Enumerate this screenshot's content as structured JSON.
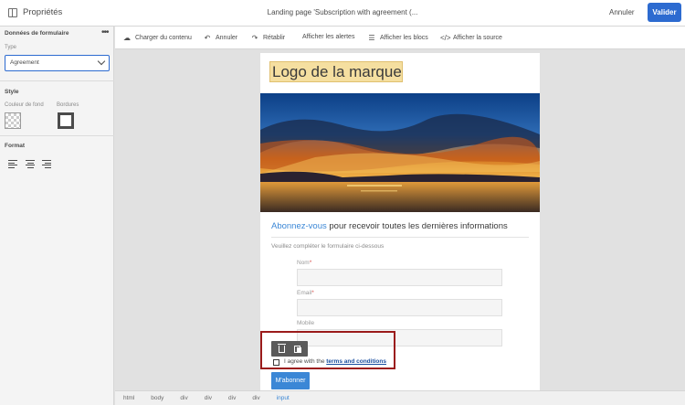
{
  "header": {
    "panel_title": "Propriétés",
    "document_title": "Landing page 'Subscription with agreement (...",
    "cancel_label": "Annuler",
    "validate_label": "Valider"
  },
  "left_panel": {
    "section_title": "Données de formulaire",
    "more_label": "•••",
    "type_label": "Type",
    "type_value": "Agreement",
    "style_title": "Style",
    "background_label": "Couleur de fond",
    "border_label": "Bordures",
    "format_title": "Format",
    "align_buttons": [
      "align-left",
      "align-center",
      "align-right"
    ]
  },
  "toolbar": {
    "items": [
      {
        "label": "Charger du contenu",
        "icon": "cloud-upload-icon"
      },
      {
        "label": "Annuler",
        "icon": "undo-icon"
      },
      {
        "label": "Rétablir",
        "icon": "redo-icon"
      },
      {
        "label": "Afficher les alertes",
        "icon": ""
      },
      {
        "label": "Afficher les blocs",
        "icon": "blocks-icon"
      },
      {
        "label": "Afficher la source",
        "icon": "code-icon"
      }
    ]
  },
  "content": {
    "logo_text": "Logo de la marque",
    "headline_link": "Abonnez-vous",
    "headline_rest": " pour recevoir toutes les dernières informations",
    "intro": "Veuillez compléter le formulaire ci-dessous",
    "fields": [
      {
        "label": "Nom",
        "required": "*"
      },
      {
        "label": "Email",
        "required": "*"
      },
      {
        "label": "Mobile",
        "required": ""
      }
    ],
    "agree_text": "I agree with the ",
    "terms_text": "terms and conditions",
    "subscribe_label": "M'abonner"
  },
  "breadcrumb": [
    "html",
    "body",
    "div",
    "div",
    "div",
    "div",
    "input"
  ],
  "colors": {
    "accent": "#2d6bd0",
    "link": "#3b87d6",
    "selection": "#9b1b1b",
    "logo_bg": "#f5dfa0"
  }
}
